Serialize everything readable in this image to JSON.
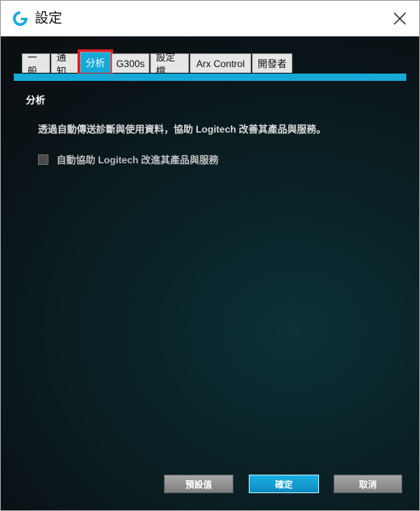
{
  "window": {
    "title": "設定",
    "icon": "logitech-g-icon",
    "close_icon": "close-icon"
  },
  "tabs": [
    {
      "label": "一般",
      "active": false
    },
    {
      "label": "通知",
      "active": false
    },
    {
      "label": "分析",
      "active": true
    },
    {
      "label": "G300s",
      "active": false
    },
    {
      "label": "設定檔",
      "active": false
    },
    {
      "label": "Arx Control",
      "active": false
    },
    {
      "label": "開發者",
      "active": false
    }
  ],
  "analytics": {
    "section_title": "分析",
    "description": "透過自動傳送診斷與使用資料，協助 Logitech 改善其產品與服務。",
    "checkbox_label": "自動協助 Logitech 改進其產品與服務",
    "checkbox_checked": false
  },
  "buttons": {
    "defaults": "預設值",
    "ok": "確定",
    "cancel": "取消"
  },
  "colors": {
    "accent": "#16a9d8",
    "highlight_frame": "#e01b24"
  }
}
